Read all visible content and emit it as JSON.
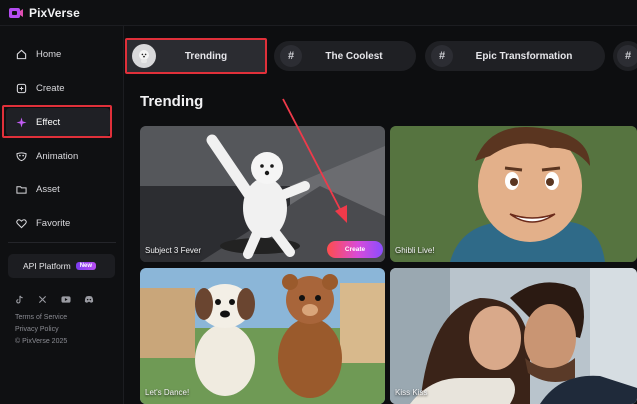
{
  "app": {
    "name": "PixVerse"
  },
  "sidebar": {
    "items": [
      {
        "label": "Home",
        "icon": "home-icon"
      },
      {
        "label": "Create",
        "icon": "create-icon"
      },
      {
        "label": "Effect",
        "icon": "sparkle-icon",
        "active": true
      },
      {
        "label": "Animation",
        "icon": "mask-icon"
      },
      {
        "label": "Asset",
        "icon": "folder-icon"
      },
      {
        "label": "Favorite",
        "icon": "heart-icon"
      }
    ],
    "api": {
      "label": "API Platform",
      "badge": "New"
    },
    "social": [
      "tiktok-icon",
      "x-icon",
      "youtube-icon",
      "discord-icon"
    ],
    "footer": {
      "terms": "Terms of Service",
      "privacy": "Privacy Policy",
      "copyright": "© PixVerse 2025"
    }
  },
  "tabs": [
    {
      "label": "Trending",
      "active": true
    },
    {
      "label": "The Coolest"
    },
    {
      "label": "Epic Transformation"
    }
  ],
  "section": {
    "title": "Trending"
  },
  "cards": [
    {
      "label": "Subject 3 Fever",
      "create": "Create"
    },
    {
      "label": "Ghibli Live!"
    },
    {
      "label": "Let's Dance!"
    },
    {
      "label": "Kiss Kiss"
    }
  ],
  "colors": {
    "highlight": "#e0303a",
    "accent_gradient_start": "#ff4d4d",
    "accent_gradient_end": "#8a4dff",
    "background": "#0d0e10"
  }
}
